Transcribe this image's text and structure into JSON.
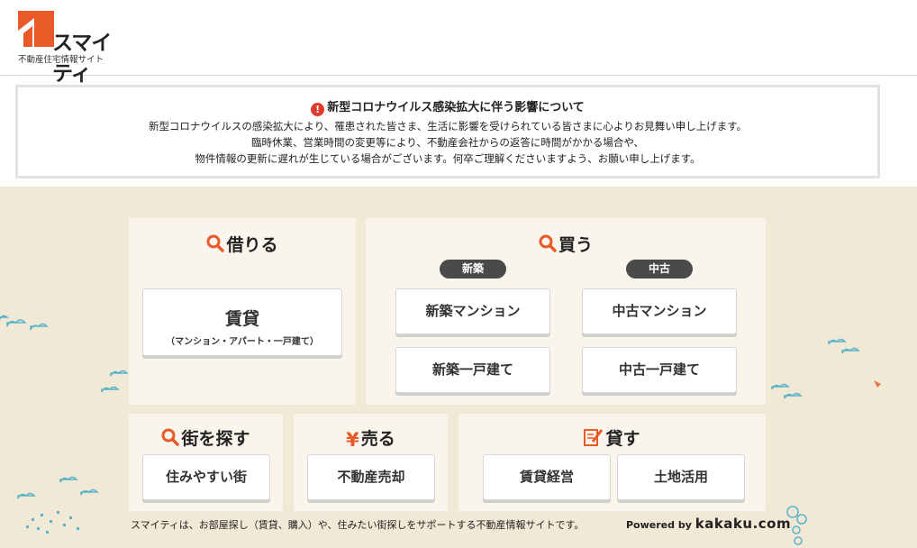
{
  "header": {
    "logo_text": "スマイティ",
    "logo_subtitle": "不動産住宅情報サイト"
  },
  "notice": {
    "title": "新型コロナウイルス感染拡大に伴う影響について",
    "line1": "新型コロナウイルスの感染拡大により、罹患された皆さま、生活に影響を受けられている皆さまに心よりお見舞い申し上げます。",
    "line2": "臨時休業、営業時間の変更等により、不動産会社からの返答に時間がかかる場合や、",
    "line3": "物件情報の更新に遅れが生じている場合がございます。何卒ご理解くださいますよう、お願い申し上げます。"
  },
  "rent": {
    "title": "借りる",
    "button_label": "賃貸",
    "button_sub": "（マンション・アパート・一戸建て）"
  },
  "buy": {
    "title": "買う",
    "new_tag": "新築",
    "used_tag": "中古",
    "new_mansion": "新築マンション",
    "new_house": "新築一戸建て",
    "used_mansion": "中古マンション",
    "used_house": "中古一戸建て"
  },
  "town": {
    "title": "街を探す",
    "button": "住みやすい街"
  },
  "sell": {
    "title": "売る",
    "icon_glyph": "¥",
    "button": "不動産売却"
  },
  "lend": {
    "title": "貸す",
    "button1": "賃貸経営",
    "button2": "土地活用"
  },
  "footer": {
    "description": "スマイティは、お部屋探し（賃貸、購入）や、住みたい街探しをサポートする不動産情報サイトです。",
    "powered_by": "Powered by",
    "partner": "kakaku.com"
  },
  "colors": {
    "accent": "#ea5a28",
    "background": "#f1e8d6",
    "panel": "#faf5ec",
    "tag": "#4a4a4a",
    "cloud": "#5ab4c8"
  }
}
